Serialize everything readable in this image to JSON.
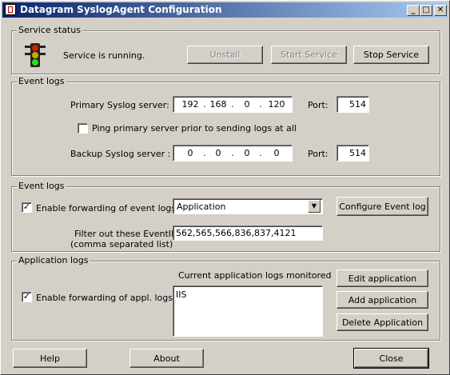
{
  "window": {
    "title": "Datagram SyslogAgent Configuration",
    "min_glyph": "_",
    "max_glyph": "□",
    "close_glyph": "✕"
  },
  "service_status": {
    "group_label": "Service status",
    "status_text": "Service is running.",
    "uninstall_label": "Unstall",
    "start_label": "Start Service",
    "stop_label": "Stop Service"
  },
  "syslog_servers": {
    "group_label": "Event logs",
    "primary_label": "Primary Syslog server:",
    "primary_ip": [
      "192",
      "168",
      "0",
      "120"
    ],
    "primary_port_label": "Port:",
    "primary_port": "514",
    "ping_label": "Ping primary server prior to sending logs at all",
    "backup_label": "Backup Syslog server :",
    "backup_ip": [
      "0",
      "0",
      "0",
      "0"
    ],
    "backup_port_label": "Port:",
    "backup_port": "514",
    "ip_dot": "."
  },
  "event_logs": {
    "group_label": "Event logs",
    "enable_label": "Enable forwarding of event logs",
    "enable_checked": "✓",
    "log_select_value": "Application",
    "configure_label": "Configure Event log",
    "filter_label_line1": "Filter out these EventIDs:",
    "filter_label_line2": "(comma separated list)",
    "filter_value": "562,565,566,836,837,4121"
  },
  "application_logs": {
    "group_label": "Application logs",
    "monitored_label": "Current application logs monitored",
    "enable_label": "Enable forwarding of appl. logs",
    "enable_checked": "✓",
    "list_items": [
      "IIS"
    ],
    "edit_label": "Edit application",
    "add_label": "Add application",
    "delete_label": "Delete Application"
  },
  "footer": {
    "help_label": "Help",
    "about_label": "About",
    "close_label": "Close"
  },
  "colors": {
    "titlebar_start": "#0a246a",
    "face": "#d4d0c8",
    "light_red": "#cc2200",
    "light_yellow": "#ccaa00",
    "light_green": "#22dd22"
  }
}
